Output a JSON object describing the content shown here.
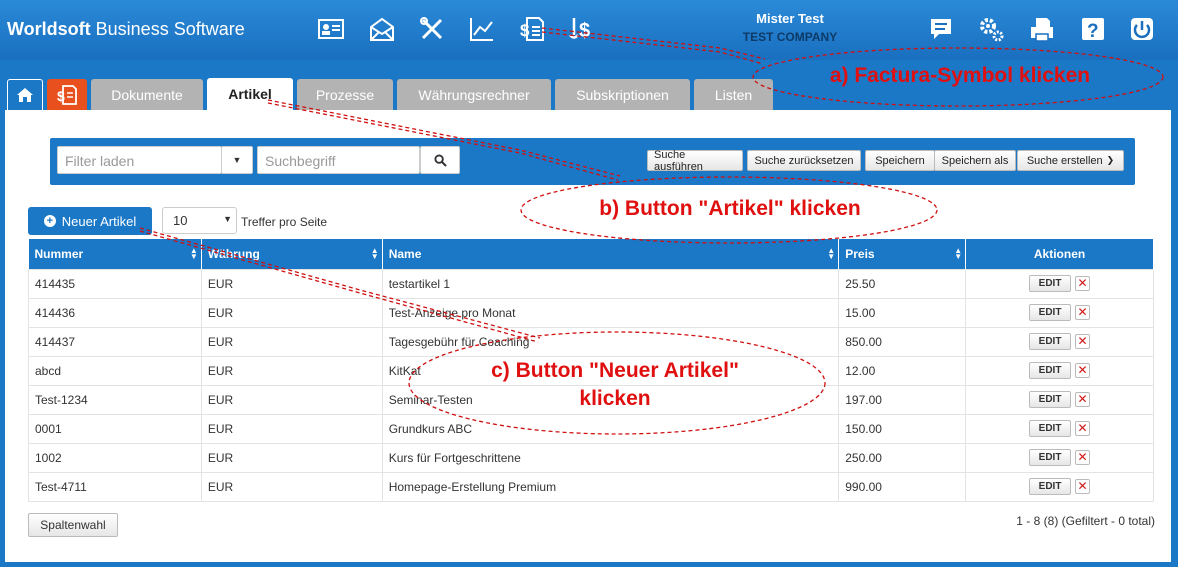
{
  "header": {
    "brand_bold": "Worldsoft",
    "brand_rest": " Business Software",
    "user_name": "Mister Test",
    "company": "TEST COMPANY"
  },
  "tabs": [
    {
      "label": "Dokumente"
    },
    {
      "label": "Artikel"
    },
    {
      "label": "Prozesse"
    },
    {
      "label": "Währungsrechner"
    },
    {
      "label": "Subskriptionen"
    },
    {
      "label": "Listen"
    }
  ],
  "filter": {
    "load_placeholder": "Filter laden",
    "search_placeholder": "Suchbegriff",
    "buttons": {
      "run": "Suche ausführen",
      "reset": "Suche zurücksetzen",
      "save": "Speichern",
      "save_as": "Speichern als",
      "create": "Suche erstellen"
    }
  },
  "toolbar": {
    "new_article": "Neuer Artikel",
    "per_page": "10",
    "per_page_label": "Treffer pro Seite"
  },
  "table": {
    "headers": {
      "number": "Nummer",
      "currency": "Währung",
      "name": "Name",
      "price": "Preis",
      "actions": "Aktionen"
    },
    "edit_label": "EDIT",
    "delete_label": "✕",
    "rows": [
      {
        "number": "414435",
        "currency": "EUR",
        "name": "testartikel 1",
        "price": "25.50"
      },
      {
        "number": "414436",
        "currency": "EUR",
        "name": "Test-Anzeige pro Monat",
        "price": "15.00"
      },
      {
        "number": "414437",
        "currency": "EUR",
        "name": "Tagesgebühr für Coaching",
        "price": "850.00"
      },
      {
        "number": "abcd",
        "currency": "EUR",
        "name": "KitKat",
        "price": "12.00"
      },
      {
        "number": "Test-1234",
        "currency": "EUR",
        "name": "Seminar-Testen",
        "price": "197.00"
      },
      {
        "number": "0001",
        "currency": "EUR",
        "name": "Grundkurs ABC",
        "price": "150.00"
      },
      {
        "number": "1002",
        "currency": "EUR",
        "name": "Kurs für Fortgeschrittene",
        "price": "250.00"
      },
      {
        "number": "Test-4711",
        "currency": "EUR",
        "name": "Homepage-Erstellung Premium",
        "price": "990.00"
      }
    ]
  },
  "footer": {
    "columns_button": "Spaltenwahl",
    "page_info": "1 - 8 (8) (Gefiltert - 0 total)"
  },
  "annotations": {
    "a": "a) Factura-Symbol klicken",
    "b": "b) Button \"Artikel\" klicken",
    "c_line1": "c) Button \"Neuer Artikel\"",
    "c_line2": "klicken"
  },
  "colors": {
    "primary": "#1a78c7",
    "accent": "#e8501e",
    "annotation": "#e01010"
  }
}
